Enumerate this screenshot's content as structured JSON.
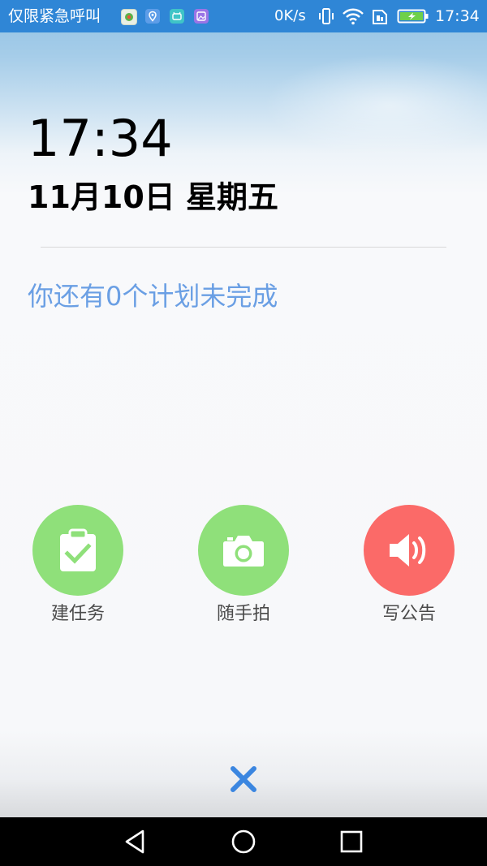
{
  "status_bar": {
    "carrier_text": "仅限紧急呼叫",
    "net_speed": "0K/s",
    "time": "17:34",
    "icons": [
      "app-icon-1",
      "location-icon",
      "app-icon-3",
      "gallery-icon",
      "vibrate-icon",
      "wifi-icon",
      "sim-icon",
      "battery-charging-icon"
    ]
  },
  "lock": {
    "time": "17:34",
    "date": "11月10日 星期五",
    "plan_message": "你还有0个计划未完成"
  },
  "actions": [
    {
      "label": "建任务",
      "icon": "clipboard-check-icon",
      "color": "#8fe07a"
    },
    {
      "label": "随手拍",
      "icon": "camera-icon",
      "color": "#8fe07a"
    },
    {
      "label": "写公告",
      "icon": "speaker-icon",
      "color": "#fb6a68"
    }
  ],
  "close": {
    "icon": "close-icon",
    "color": "#3b86e0"
  },
  "nav": {
    "back": "back-icon",
    "home": "home-icon",
    "recents": "recents-icon"
  }
}
